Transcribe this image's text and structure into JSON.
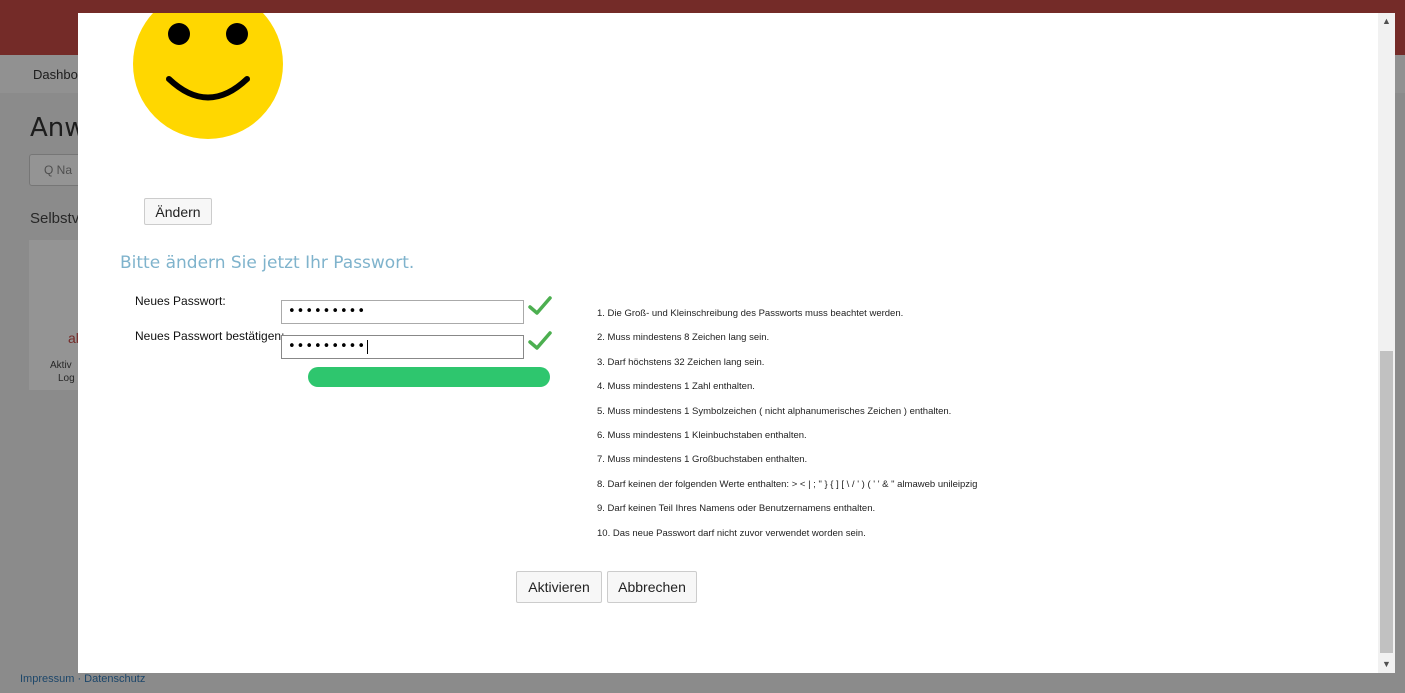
{
  "background": {
    "nav_item": "Dashbo",
    "heading": "Anwe",
    "search_placeholder": "Q Na",
    "section": "Selbstv",
    "card_line1": "U",
    "card_line2": "al",
    "card_text1": "Aktiv",
    "card_text2": "Log",
    "footer_links": "Impressum · Datenschutz"
  },
  "modal": {
    "change_button": "Ändern",
    "section_title": "Bitte ändern Sie jetzt Ihr Passwort.",
    "new_password_label": "Neues Passwort:",
    "new_password_value": "•••••••••",
    "confirm_password_label": "Neues Passwort bestätigen:",
    "confirm_password_value": "•••••••••",
    "rules": [
      "1. Die Groß- und Kleinschreibung des Passworts muss beachtet werden.",
      "2. Muss mindestens 8 Zeichen lang sein.",
      "3. Darf höchstens 32 Zeichen lang sein.",
      "4. Muss mindestens 1 Zahl enthalten.",
      "5. Muss mindestens 1 Symbolzeichen ( nicht alphanumerisches Zeichen ) enthalten.",
      "6. Muss mindestens 1 Kleinbuchstaben enthalten.",
      "7. Muss mindestens 1 Großbuchstaben enthalten.",
      "8. Darf keinen der folgenden Werte enthalten: > < | ; \" } { ] [ \\ / ' ) ( ' ' & \" almaweb unileipzig",
      "9. Darf keinen Teil Ihres Namens oder Benutzernamens enthalten.",
      "10. Das neue Passwort darf nicht zuvor verwendet worden sein."
    ],
    "activate_button": "Aktivieren",
    "cancel_button": "Abbrechen"
  },
  "colors": {
    "topbar": "#c94a46",
    "section_title": "#7fb3cc",
    "strength_bar": "#2ec66e",
    "check_icon": "#4caf50",
    "smiley_face": "#ffd700"
  },
  "icons": {
    "valid": "check-icon",
    "avatar": "smiley-icon"
  }
}
